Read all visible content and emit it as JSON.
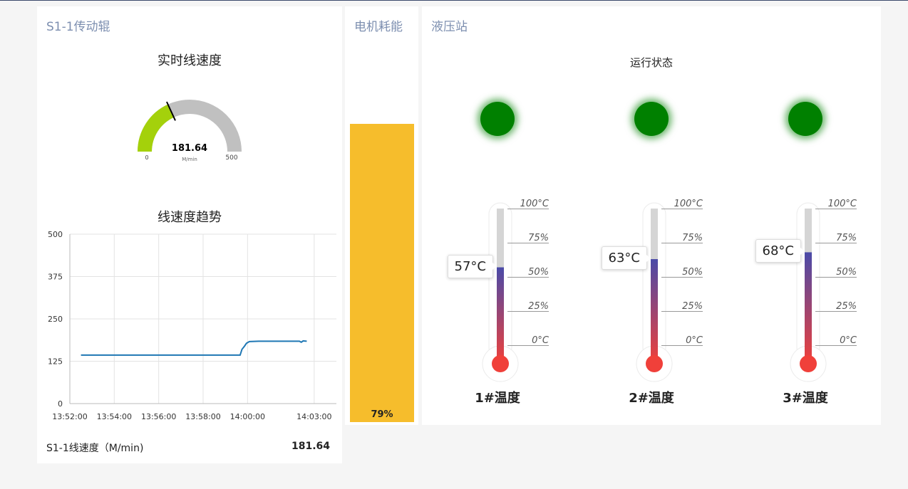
{
  "s1": {
    "title": "S1-1传动辊",
    "gauge": {
      "title": "实时线速度",
      "value": 181.64,
      "value_text": "181.64",
      "min": 0,
      "max": 500,
      "min_label": "0",
      "max_label": "500",
      "unit": "M/min",
      "fill_color": "#a4d10b",
      "track_color": "#c0c0c0"
    },
    "trend_title": "线速度趋势",
    "footer": {
      "label": "S1-1线速度（M/min)",
      "value": "181.64"
    }
  },
  "motor": {
    "title": "电机耗能",
    "value": 79,
    "value_text": "79%",
    "color": "#f6bd2c"
  },
  "hydraulic": {
    "title": "液压站",
    "status_title": "运行状态",
    "leds": [
      {
        "name": "led-1",
        "color": "#008000"
      },
      {
        "name": "led-2",
        "color": "#008000"
      },
      {
        "name": "led-3",
        "color": "#008000"
      }
    ],
    "scale_labels": [
      "100°C",
      "75%",
      "50%",
      "25%",
      "0°C"
    ],
    "thermometers": [
      {
        "label": "1#温度",
        "value": 57,
        "value_text": "57°C"
      },
      {
        "label": "2#温度",
        "value": 63,
        "value_text": "63°C"
      },
      {
        "label": "3#温度",
        "value": 68,
        "value_text": "68°C"
      }
    ]
  },
  "chart_data": {
    "type": "line",
    "title": "线速度趋势",
    "y_ticks": [
      "500",
      "375",
      "250",
      "125",
      "0"
    ],
    "x_ticks": [
      "13:52:00",
      "13:54:00",
      "13:56:00",
      "13:58:00",
      "14:00:00",
      "14:03:00"
    ],
    "ylim": [
      0,
      500
    ],
    "grid": true,
    "series": [
      {
        "color": "#1f77b4",
        "points": [
          [
            "13:52:30",
            143
          ],
          [
            "13:54:00",
            143
          ],
          [
            "13:56:00",
            143
          ],
          [
            "13:58:00",
            143
          ],
          [
            "13:59:40",
            143
          ],
          [
            "13:59:45",
            160
          ],
          [
            "13:59:52",
            170
          ],
          [
            "13:59:57",
            178
          ],
          [
            "14:00:05",
            183
          ],
          [
            "14:00:30",
            184
          ],
          [
            "14:01:30",
            184
          ],
          [
            "14:02:20",
            184
          ],
          [
            "14:02:25",
            181
          ],
          [
            "14:02:30",
            185
          ],
          [
            "14:02:40",
            184
          ]
        ]
      }
    ]
  }
}
